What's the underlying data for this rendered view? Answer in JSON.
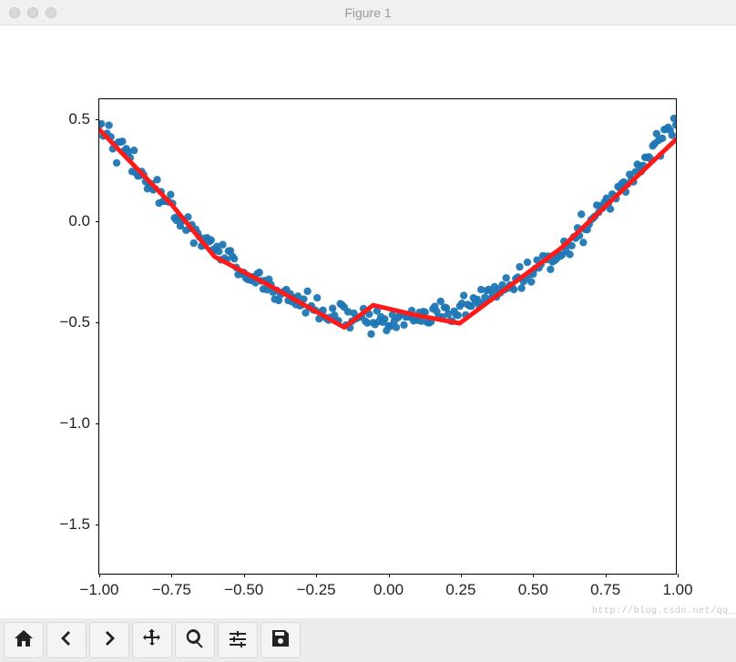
{
  "window": {
    "title": "Figure 1"
  },
  "chart_data": {
    "type": "scatter+line",
    "xlabel": "",
    "ylabel": "",
    "xlim": [
      -1.0,
      1.0
    ],
    "ylim": [
      -1.75,
      0.6
    ],
    "xticks": [
      -1.0,
      -0.75,
      -0.5,
      -0.25,
      0.0,
      0.25,
      0.5,
      0.75,
      1.0
    ],
    "yticks": [
      -1.5,
      -1.0,
      -0.5,
      0.0,
      0.5
    ],
    "scatter": {
      "description": "approx y = x^2 - 0.5 with gaussian noise sigma~0.03, 300 points on x in [-1,1]",
      "color": "#1f77b4",
      "n_points": 300,
      "x_range": [
        -1.0,
        1.0
      ],
      "base_fn": "x*x - 0.5",
      "noise_sigma": 0.03
    },
    "line": {
      "color": "#ff1a1a",
      "width": 5,
      "x": [
        -1.0,
        -0.75,
        -0.6,
        -0.4,
        -0.15,
        -0.05,
        0.1,
        0.25,
        0.4,
        0.6,
        0.8,
        1.0
      ],
      "y": [
        0.45,
        0.08,
        -0.18,
        -0.33,
        -0.53,
        -0.42,
        -0.47,
        -0.51,
        -0.35,
        -0.14,
        0.13,
        0.4
      ]
    }
  },
  "xtick_labels": [
    "−1.00",
    "−0.75",
    "−0.50",
    "−0.25",
    "0.00",
    "0.25",
    "0.50",
    "0.75",
    "1.00"
  ],
  "ytick_labels": [
    "−1.5",
    "−1.0",
    "−0.5",
    "0.0",
    "0.5"
  ],
  "toolbar": {
    "home": "Home",
    "back": "Back",
    "forward": "Forward",
    "pan": "Pan",
    "zoom": "Zoom",
    "configure": "Configure subplots",
    "save": "Save"
  },
  "watermark": "http://blog.csdn.net/qq_"
}
